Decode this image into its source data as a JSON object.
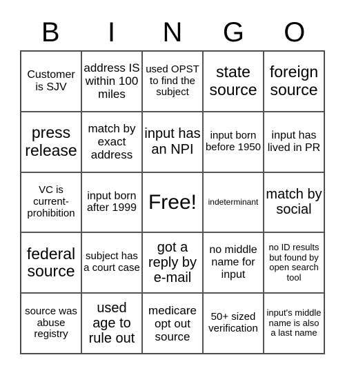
{
  "header": [
    "B",
    "I",
    "N",
    "G",
    "O"
  ],
  "cells": [
    [
      "Customer is SJV",
      "address IS within 100 miles",
      "used OPST to find the subject",
      "state source",
      "foreign source"
    ],
    [
      "press release",
      "match by exact address",
      "input has an NPI",
      "input born before 1950",
      "input has lived in PR"
    ],
    [
      "VC is current-prohibition",
      "input born after 1999",
      "Free!",
      "indeterminant",
      "match by social"
    ],
    [
      "federal source",
      "subject has a court case",
      "got a reply by e-mail",
      "no middle name for input",
      "no ID results but found by open search tool"
    ],
    [
      "source was abuse registry",
      "used age to rule out",
      "medicare opt out source",
      "50+ sized verification",
      "input's middle name is also a last name"
    ]
  ]
}
